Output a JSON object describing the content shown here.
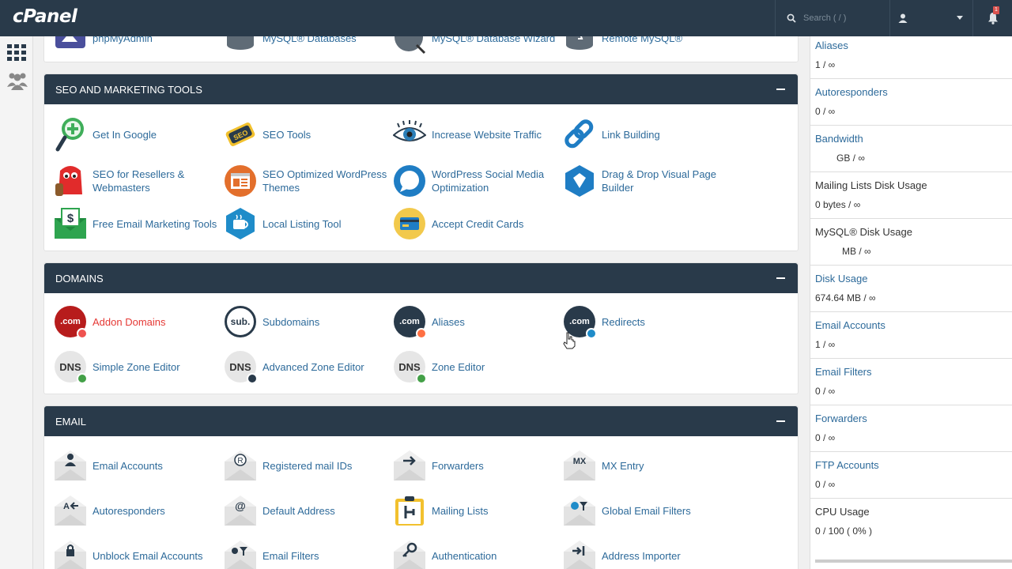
{
  "header": {
    "logo": "cPanel",
    "search_placeholder": "Search ( / )",
    "notification_count": "1"
  },
  "panels": {
    "top_partial": {
      "items": [
        "phpMyAdmin",
        "MySQL® Databases",
        "MySQL® Database Wizard",
        "Remote MySQL®"
      ]
    },
    "seo": {
      "title": "SEO AND MARKETING TOOLS",
      "items": [
        {
          "line1": "Get In Google",
          "line2": ""
        },
        {
          "line1": "SEO Tools",
          "line2": ""
        },
        {
          "line1": "Increase Website Traffic",
          "line2": ""
        },
        {
          "line1": "Link Building",
          "line2": ""
        },
        {
          "line1": "SEO for Resellers &",
          "line2": "Webmasters"
        },
        {
          "line1": "SEO Optimized WordPress",
          "line2": "Themes"
        },
        {
          "line1": "WordPress Social Media",
          "line2": "Optimization"
        },
        {
          "line1": "Drag & Drop Visual Page",
          "line2": "Builder"
        },
        {
          "line1": "Free Email Marketing Tools",
          "line2": ""
        },
        {
          "line1": "Local Listing Tool",
          "line2": ""
        },
        {
          "line1": "Accept Credit Cards",
          "line2": ""
        }
      ]
    },
    "domains": {
      "title": "DOMAINS",
      "items": [
        "Addon Domains",
        "Subdomains",
        "Aliases",
        "Redirects",
        "Simple Zone Editor",
        "Advanced Zone Editor",
        "Zone Editor"
      ],
      "icon_text": {
        "dotcom": ".com",
        "sub": "sub.",
        "dns": "DNS"
      }
    },
    "email": {
      "title": "EMAIL",
      "items": [
        "Email Accounts",
        "Registered mail IDs",
        "Forwarders",
        "MX Entry",
        "Autoresponders",
        "Default Address",
        "Mailing Lists",
        "Global Email Filters",
        "Unblock Email Accounts",
        "Email Filters",
        "Authentication",
        "Address Importer"
      ],
      "icon_text": {
        "mx": "MX",
        "autoresponder": "A",
        "registered": "R",
        "default": "@"
      }
    }
  },
  "stats": [
    {
      "label": "Aliases",
      "value": "1 / ∞"
    },
    {
      "label": "Autoresponders",
      "value": "0 / ∞"
    },
    {
      "label": "Bandwidth",
      "value": "GB / ∞"
    },
    {
      "label": "Mailing Lists Disk Usage",
      "value": "0 bytes / ∞"
    },
    {
      "label": "MySQL® Disk Usage",
      "value": "MB / ∞"
    },
    {
      "label": "Disk Usage",
      "value": "674.64 MB / ∞"
    },
    {
      "label": "Email Accounts",
      "value": "1 / ∞"
    },
    {
      "label": "Email Filters",
      "value": "0 / ∞"
    },
    {
      "label": "Forwarders",
      "value": "0 / ∞"
    },
    {
      "label": "FTP Accounts",
      "value": "0 / ∞"
    },
    {
      "label": "CPU Usage",
      "value": "0 / 100 ( 0% )"
    }
  ],
  "colors": {
    "header_bg": "#293a4a",
    "link": "#2d6a9a",
    "addon_red": "#e53935"
  }
}
